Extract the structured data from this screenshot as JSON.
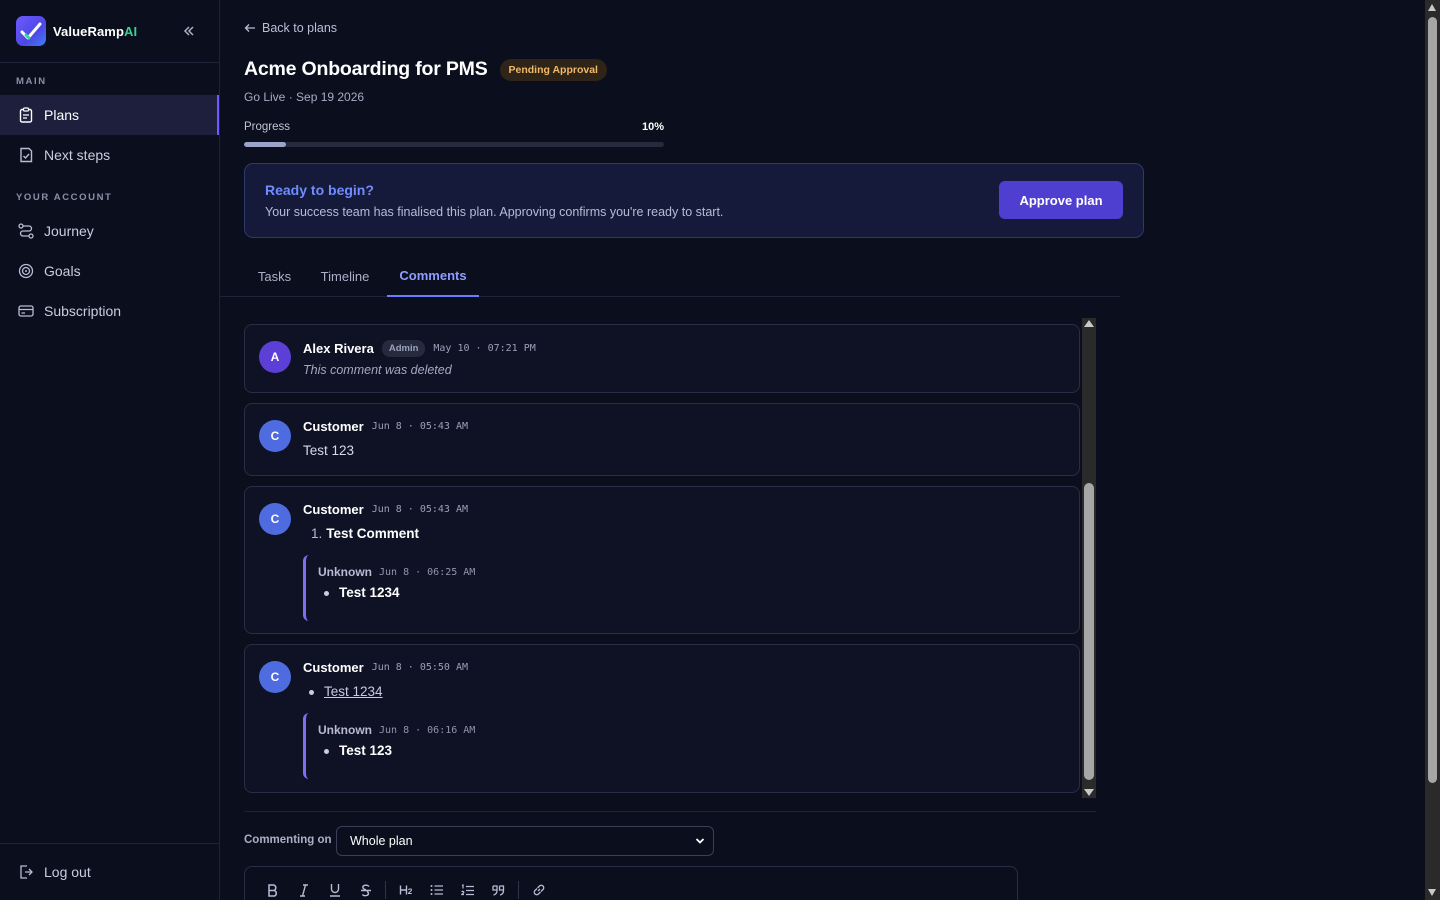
{
  "brand": {
    "name": "ValueRamp",
    "suffix": "AI"
  },
  "sidebar": {
    "main_label": "MAIN",
    "main_items": [
      {
        "label": "Plans",
        "icon": "clipboard-icon",
        "active": true
      },
      {
        "label": "Next steps",
        "icon": "checklist-icon",
        "active": false
      }
    ],
    "account_label": "YOUR ACCOUNT",
    "account_items": [
      {
        "label": "Journey",
        "icon": "route-icon"
      },
      {
        "label": "Goals",
        "icon": "target-icon"
      },
      {
        "label": "Subscription",
        "icon": "credit-card-icon"
      }
    ],
    "logout_label": "Log out"
  },
  "header": {
    "back_label": "Back to plans",
    "title": "Acme Onboarding for PMS",
    "status": "Pending Approval",
    "subtitle": "Go Live · Sep 19 2026",
    "progress_label": "Progress",
    "progress_value": "10%",
    "progress_fraction": 0.1
  },
  "banner": {
    "title": "Ready to begin?",
    "text": "Your success team has finalised this plan. Approving confirms you're ready to start.",
    "button": "Approve plan"
  },
  "tabs": [
    "Tasks",
    "Timeline",
    "Comments"
  ],
  "active_tab": "Comments",
  "comments": [
    {
      "avatar": "A",
      "author": "Alex Rivera",
      "role": "Admin",
      "time": "May 10 · 07:21 PM",
      "deleted_text": "This comment was deleted"
    },
    {
      "avatar": "C",
      "author": "Customer",
      "time": "Jun 8 · 05:43 AM",
      "body": "Test 123"
    },
    {
      "avatar": "C",
      "author": "Customer",
      "time": "Jun 8 · 05:43 AM",
      "list_number": "1.",
      "body": "Test Comment",
      "reply": {
        "author": "Unknown",
        "time": "Jun 8 · 06:25 AM",
        "body": "Test 1234"
      }
    },
    {
      "avatar": "C",
      "author": "Customer",
      "time": "Jun 8 · 05:50 AM",
      "body": "Test 1234",
      "reply": {
        "author": "Unknown",
        "time": "Jun 8 · 06:16 AM",
        "body": "Test 123"
      }
    }
  ],
  "composer": {
    "commenting_on_label": "Commenting on",
    "scope_value": "Whole plan",
    "toolbar": [
      "bold-icon",
      "italic-icon",
      "underline-icon",
      "strikethrough-icon",
      "heading-icon",
      "bullet-list-icon",
      "numbered-list-icon",
      "quote-icon",
      "link-icon"
    ]
  },
  "colors": {
    "accent": "#4f3fd0",
    "link": "#6f8dff",
    "badge": "#f2b968",
    "ai": "#34d399"
  }
}
